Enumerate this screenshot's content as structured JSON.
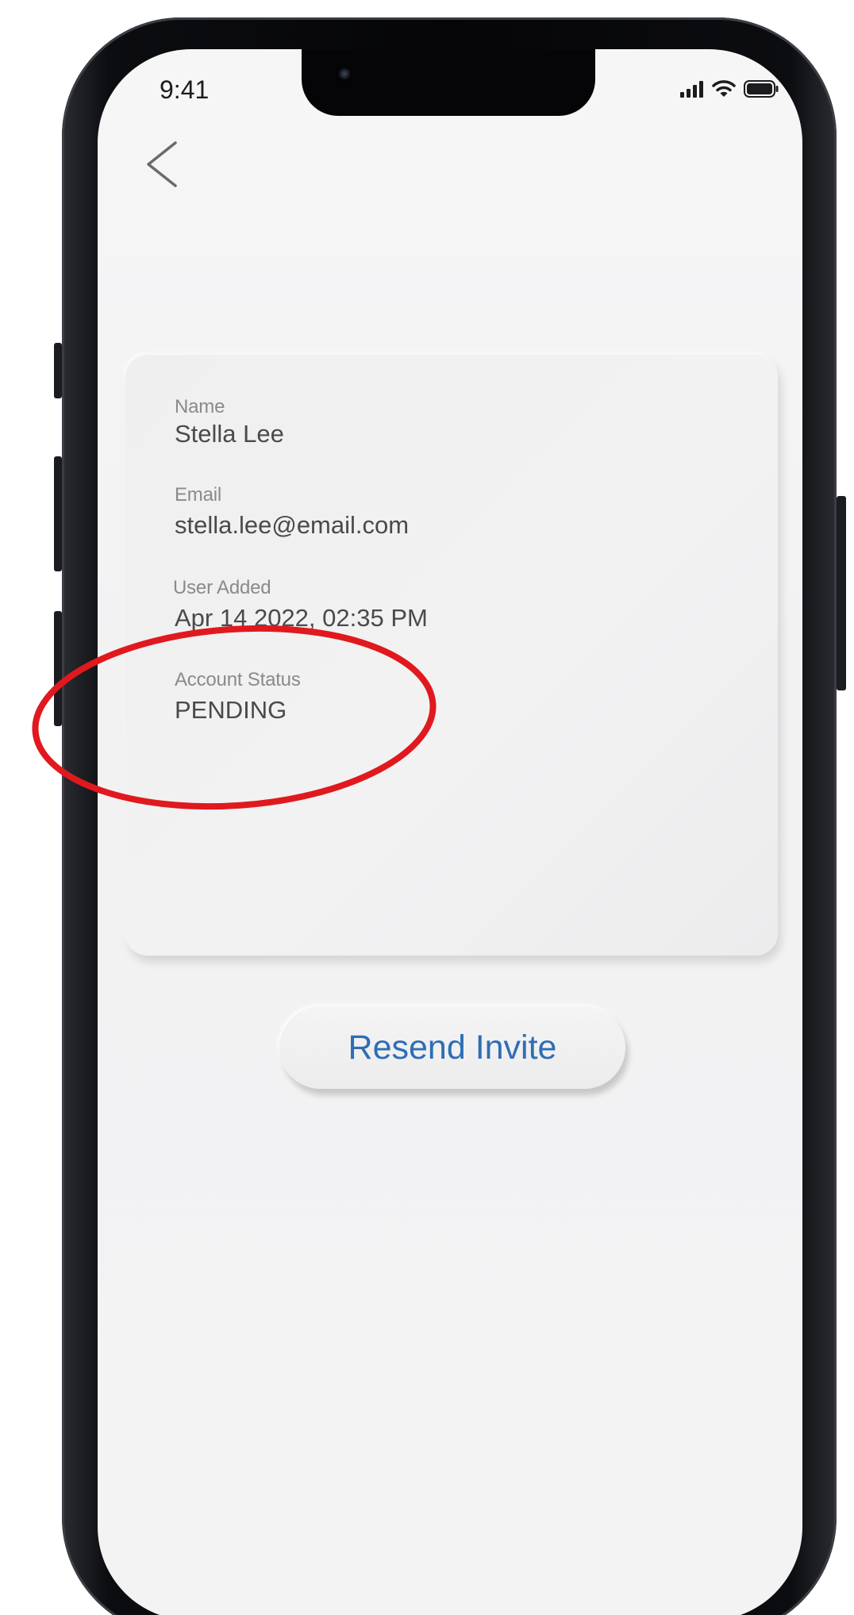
{
  "status_bar": {
    "time": "9:41",
    "icons": [
      "signal-icon",
      "wifi-icon",
      "battery-icon"
    ]
  },
  "nav": {
    "back_icon": "chevron-left-icon"
  },
  "details": {
    "name_label": "Name",
    "name_value": "Stella Lee",
    "email_label": "Email",
    "email_value": "stella.lee@email.com",
    "added_label": "User Added",
    "added_value": "Apr 14 2022, 02:35 PM",
    "status_label": "Account Status",
    "status_value": "PENDING"
  },
  "actions": {
    "resend_label": "Resend Invite"
  },
  "colors": {
    "accent": "#2f6db5",
    "annotation": "#e0191f",
    "label": "#8a8a8e",
    "value": "#4a4a4d"
  }
}
